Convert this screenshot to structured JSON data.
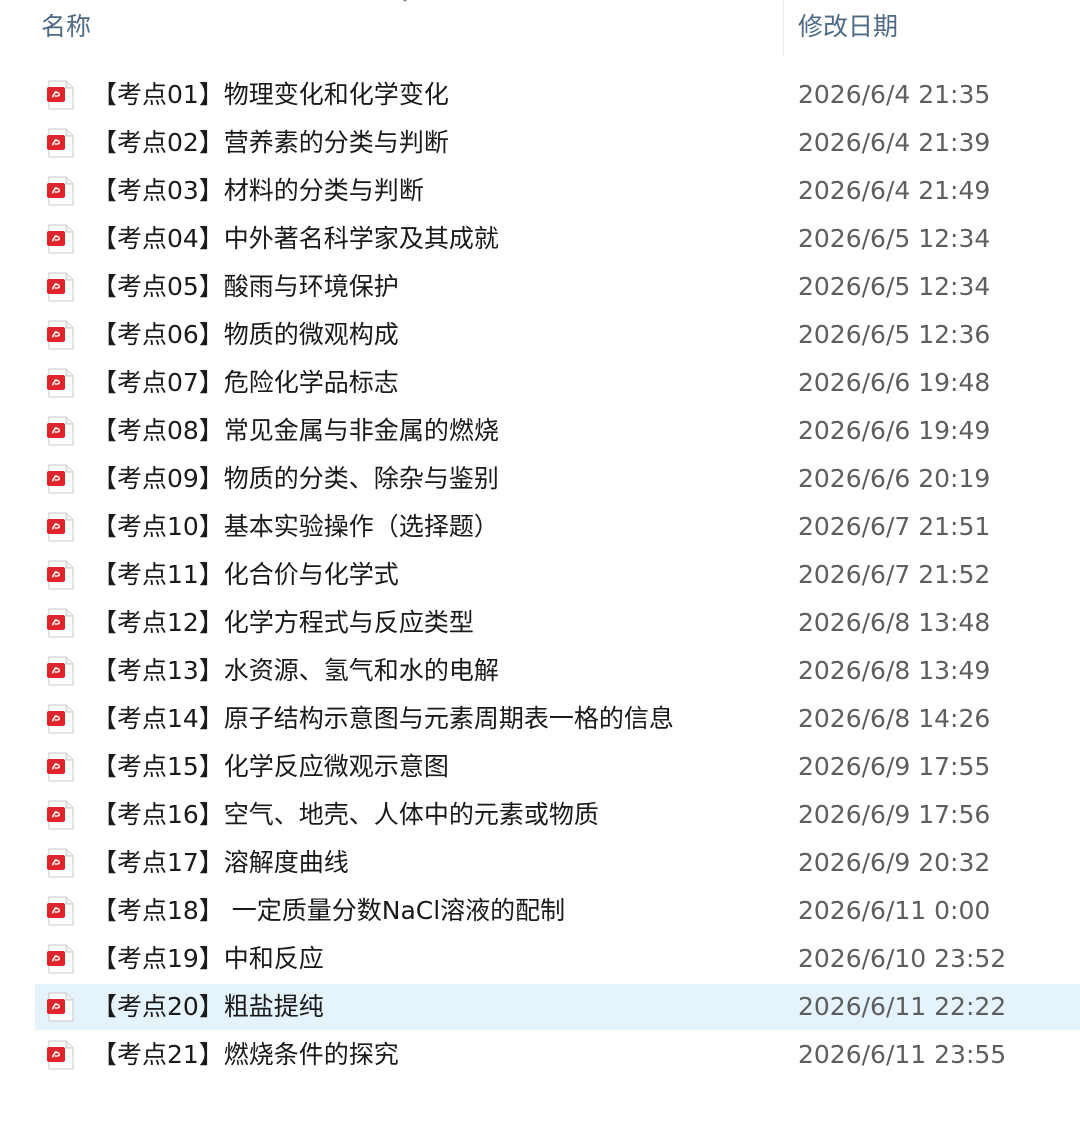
{
  "header": {
    "name_label": "名称",
    "date_label": "修改日期"
  },
  "accent_color": "#e5f3fd",
  "file_icon": "pdf-file-icon",
  "files": [
    {
      "name": "【考点01】物理变化和化学变化",
      "date": "2026/6/4 21:35"
    },
    {
      "name": "【考点02】营养素的分类与判断",
      "date": "2026/6/4 21:39"
    },
    {
      "name": "【考点03】材料的分类与判断",
      "date": "2026/6/4 21:49"
    },
    {
      "name": "【考点04】中外著名科学家及其成就",
      "date": "2026/6/5 12:34"
    },
    {
      "name": "【考点05】酸雨与环境保护",
      "date": "2026/6/5 12:34"
    },
    {
      "name": "【考点06】物质的微观构成",
      "date": "2026/6/5 12:36"
    },
    {
      "name": "【考点07】危险化学品标志",
      "date": "2026/6/6 19:48"
    },
    {
      "name": "【考点08】常见金属与非金属的燃烧",
      "date": "2026/6/6 19:49"
    },
    {
      "name": "【考点09】物质的分类、除杂与鉴别",
      "date": "2026/6/6 20:19"
    },
    {
      "name": "【考点10】基本实验操作（选择题）",
      "date": "2026/6/7 21:51"
    },
    {
      "name": "【考点11】化合价与化学式",
      "date": "2026/6/7 21:52"
    },
    {
      "name": "【考点12】化学方程式与反应类型",
      "date": "2026/6/8 13:48"
    },
    {
      "name": "【考点13】水资源、氢气和水的电解",
      "date": "2026/6/8 13:49"
    },
    {
      "name": "【考点14】原子结构示意图与元素周期表一格的信息",
      "date": "2026/6/8 14:26"
    },
    {
      "name": "【考点15】化学反应微观示意图",
      "date": "2026/6/9 17:55"
    },
    {
      "name": "【考点16】空气、地壳、人体中的元素或物质",
      "date": "2026/6/9 17:56"
    },
    {
      "name": "【考点17】溶解度曲线",
      "date": "2026/6/9 20:32"
    },
    {
      "name": "【考点18】 一定质量分数NaCl溶液的配制",
      "date": "2026/6/11 0:00"
    },
    {
      "name": "【考点19】中和反应",
      "date": "2026/6/10 23:52"
    },
    {
      "name": "【考点20】粗盐提纯",
      "date": "2026/6/11 22:22"
    },
    {
      "name": "【考点21】燃烧条件的探究",
      "date": "2026/6/11 23:55"
    }
  ],
  "selected_index": 19
}
